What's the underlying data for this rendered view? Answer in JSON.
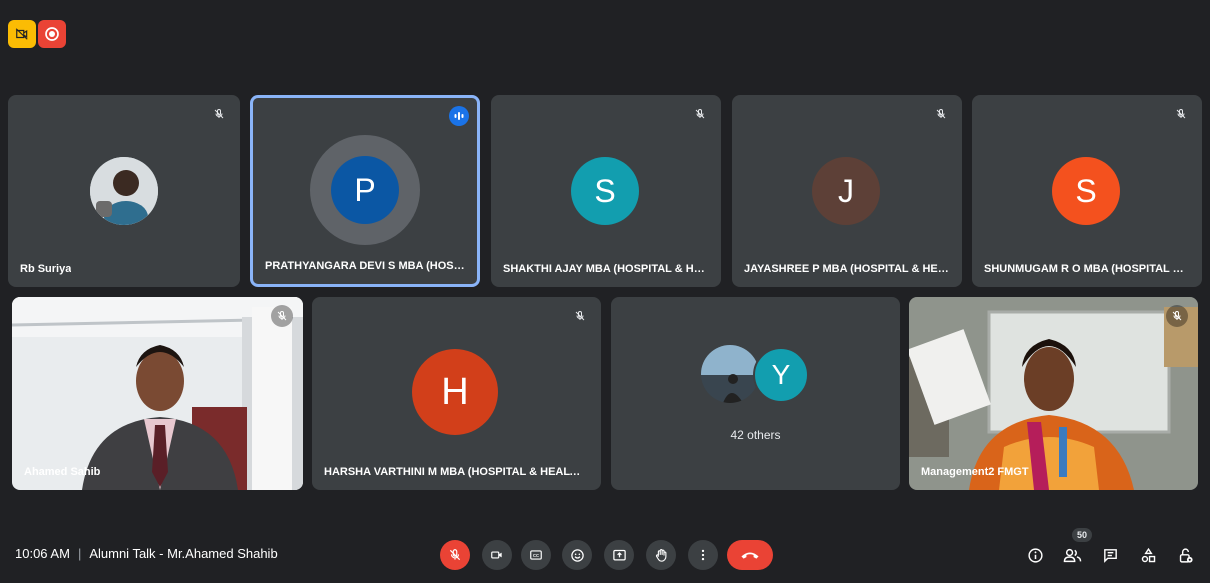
{
  "participants": {
    "rb_suriya": "Rb Suriya",
    "prathyangara": "PRATHYANGARA DEVI S MBA (HOSPI...",
    "shakthi": "SHAKTHI AJAY MBA (HOSPITAL & HE...",
    "jayashree": "JAYASHREE P MBA (HOSPITAL & HEA...",
    "shunmugam": "SHUNMUGAM R O MBA (HOSPITAL & ...",
    "ahamed": "Ahamed Sahib",
    "harsha": "HARSHA VARTHINI M MBA (HOSPITAL & HEALTH...",
    "others": "42 others",
    "management": "Management2 FMGT"
  },
  "avatars": {
    "p": "P",
    "s1": "S",
    "j": "J",
    "s2": "S",
    "h": "H",
    "y": "Y"
  },
  "colors": {
    "p": "#0b57a4",
    "s1": "#129eaf",
    "j": "#5d4037",
    "s2": "#f4511e",
    "h": "#d23f1a",
    "y": "#129eaf",
    "accent": "#8ab4f8",
    "red": "#ea4335"
  },
  "bottom": {
    "time": "10:06 AM",
    "separator": "|",
    "meeting_title": "Alumni Talk - Mr.Ahamed Shahib",
    "people_count": "50"
  },
  "icons": {
    "top_left_1": "camera-off-icon",
    "top_left_2": "record-icon",
    "controls": [
      "mic-off-icon",
      "camera-icon",
      "captions-icon",
      "emoji-icon",
      "present-icon",
      "raise-hand-icon",
      "more-icon",
      "end-call-icon"
    ],
    "right": [
      "info-icon",
      "people-icon",
      "chat-icon",
      "activities-icon",
      "host-controls-icon"
    ]
  }
}
